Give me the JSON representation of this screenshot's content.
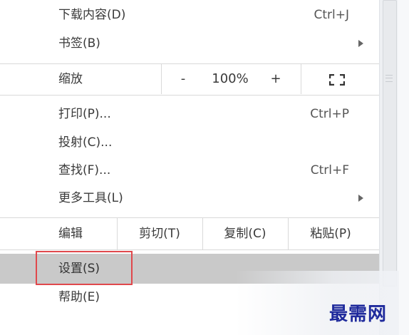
{
  "menu": {
    "downloads": {
      "label": "下载内容(D)",
      "shortcut": "Ctrl+J"
    },
    "bookmarks": {
      "label": "书签(B)"
    },
    "zoom": {
      "label": "缩放",
      "minus": "-",
      "level": "100%",
      "plus": "+"
    },
    "print": {
      "label": "打印(P)...",
      "shortcut": "Ctrl+P"
    },
    "cast": {
      "label": "投射(C)..."
    },
    "find": {
      "label": "查找(F)...",
      "shortcut": "Ctrl+F"
    },
    "more_tools": {
      "label": "更多工具(L)"
    },
    "edit": {
      "label": "编辑",
      "cut": "剪切(T)",
      "copy": "复制(C)",
      "paste": "粘贴(P)"
    },
    "settings": {
      "label": "设置(S)"
    },
    "help": {
      "label": "帮助(E)"
    }
  },
  "watermark": "最需网",
  "colors": {
    "highlight_border": "#e0484c",
    "selected_row": "#c9c9c9",
    "watermark": "#1f2a9c"
  }
}
